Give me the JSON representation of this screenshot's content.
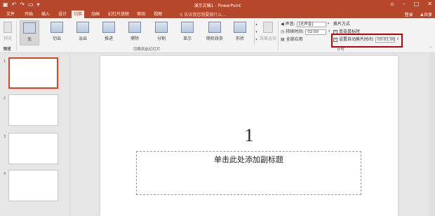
{
  "titlebar": {
    "title": "演示文稿1 - PowerPoint",
    "qat_icons": [
      "save-icon",
      "undo-icon",
      "redo-icon",
      "present-icon",
      "customize-icon"
    ]
  },
  "tabs": [
    "文件",
    "开始",
    "插入",
    "设计",
    "切换",
    "动画",
    "幻灯片放映",
    "审阅",
    "视图"
  ],
  "active_tab": "切换",
  "tell_me": "告诉我您想要做什么...",
  "account": {
    "login": "登录",
    "share": "共享"
  },
  "ribbon": {
    "preview": "预览",
    "preview_group": "预览",
    "transitions": [
      "无",
      "切出",
      "淡出",
      "推进",
      "擦除",
      "分割",
      "显示",
      "随机线条",
      "形状"
    ],
    "transitions_group": "切换到此幻灯片",
    "effect_options": "效果选项",
    "sound_label": "声音:",
    "sound_value": "[无声音]",
    "duration_label": "持续时间:",
    "duration_value": "02.00",
    "apply_all": "全部应用",
    "advance_title": "换片方式",
    "on_click": "单击鼠标时",
    "after_label": "设置自动换片时间:",
    "after_value": "00:01.00",
    "timing_group": "计时"
  },
  "slides_pane": {
    "numbers": [
      "1",
      "2",
      "3",
      "4"
    ]
  },
  "slide": {
    "number": "1",
    "subtitle_placeholder": "单击此处添加副标题"
  },
  "colors": {
    "accent": "#b7472a",
    "highlight": "#c00000"
  }
}
